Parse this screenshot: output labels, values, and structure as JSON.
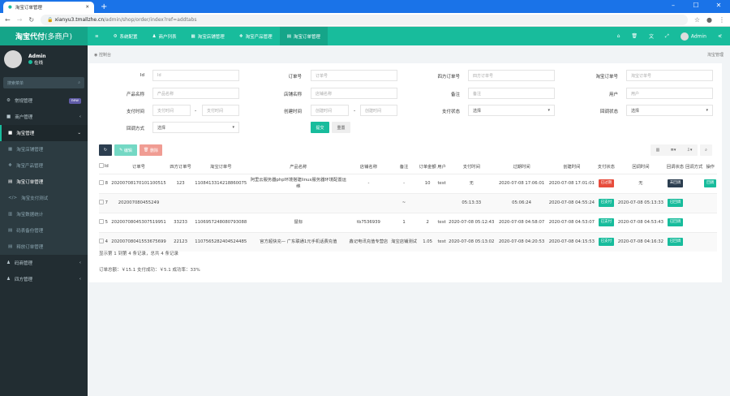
{
  "browser": {
    "tab_title": "淘宝订单管理",
    "url_domain": "xianyu3.tmallzhe.cn",
    "url_path": "/admin/shop/order/index?ref=addtabs"
  },
  "app": {
    "logo_main": "淘宝代付",
    "logo_sub": "(多商户)",
    "admin": "Admin"
  },
  "topnav": [
    {
      "label": "系统配置",
      "icon": "gear"
    },
    {
      "label": "商户列表",
      "icon": "user"
    },
    {
      "label": "淘宝店铺管理",
      "icon": "bank"
    },
    {
      "label": "淘宝产品管理",
      "icon": "cubes"
    },
    {
      "label": "淘宝订单管理",
      "icon": "id-card"
    }
  ],
  "user": {
    "name": "Admin",
    "status": "在线"
  },
  "sidebar": {
    "search_placeholder": "搜索菜单",
    "items": [
      {
        "label": "常规管理",
        "badge": "new"
      },
      {
        "label": "商户管理"
      },
      {
        "label": "淘宝管理"
      }
    ],
    "sub": [
      {
        "label": "淘宝店铺管理"
      },
      {
        "label": "淘宝产品管理"
      },
      {
        "label": "淘宝订单管理"
      },
      {
        "label": "淘宝支付测试"
      },
      {
        "label": "淘宝数据统计"
      },
      {
        "label": "码表备份管理"
      },
      {
        "label": "释放订单管理"
      }
    ],
    "bottom": [
      {
        "label": "码商管理"
      },
      {
        "label": "四方管理"
      }
    ]
  },
  "breadcrumb": {
    "left": "控制台",
    "right": "淘宝管理"
  },
  "form": {
    "id": {
      "label": "Id",
      "placeholder": "Id"
    },
    "order_no": {
      "label": "订单号",
      "placeholder": "订单号"
    },
    "sf_no": {
      "label": "四方订单号",
      "placeholder": "四方订单号"
    },
    "tb_no": {
      "label": "淘宝订单号",
      "placeholder": "淘宝订单号"
    },
    "product": {
      "label": "产品名称",
      "placeholder": "产品名称"
    },
    "shop": {
      "label": "店铺名称",
      "placeholder": "店铺名称"
    },
    "remark": {
      "label": "备注",
      "placeholder": "备注"
    },
    "user": {
      "label": "用户",
      "placeholder": "用户"
    },
    "pay_time": {
      "label": "支付时间",
      "placeholder": "支付时间"
    },
    "create_time": {
      "label": "创建时间",
      "placeholder": "创建时间"
    },
    "pay_status": {
      "label": "支付状态",
      "value": "选择"
    },
    "cb_status": {
      "label": "回调状态",
      "value": "选择"
    },
    "cb_method": {
      "label": "回调方式",
      "value": "选择"
    },
    "submit": "提交",
    "reset": "重置"
  },
  "toolbar": {
    "edit": "编辑",
    "delete": "删除"
  },
  "table": {
    "headers": [
      "Id",
      "订单号",
      "四方订单号",
      "淘宝订单号",
      "产品名称",
      "店铺名称",
      "备注",
      "订单金额",
      "用户",
      "支付时间",
      "过期时间",
      "创建时间",
      "支付状态",
      "回调时间",
      "回调状态",
      "回调方式",
      "操作"
    ],
    "rows": [
      [
        "8",
        "20200708170101100515",
        "123",
        "1108413314218860075",
        "阿里云服务器php环境搭建linux服务器环境配置运维",
        "-",
        "-",
        "10",
        "test",
        "无",
        "2020-07-08 17:06:01",
        "2020-07-08 17:01:01",
        "已过期",
        "无",
        "未回调",
        "",
        "回调"
      ],
      [
        "7",
        "202007080455249",
        "",
        "",
        "",
        "",
        "~",
        "",
        "",
        "05:13:33",
        "05:06:24",
        "2020-07-08 04:55:24",
        "已支付",
        "2020-07-08 05:13:33",
        "已回调",
        "",
        ""
      ],
      [
        "5",
        "20200708045307519951",
        "33233",
        "1106957248080793088",
        "鼠标",
        "tb7536939",
        "1",
        "2",
        "test",
        "2020-07-08 05:12:43",
        "2020-07-08 04:58:07",
        "2020-07-08 04:53:07",
        "已支付",
        "2020-07-08 04:53:43",
        "已回调",
        "",
        ""
      ],
      [
        "4",
        "20200708041553675699",
        "22123",
        "1107565282404524485",
        "官方超快充— 广东联通1元手机话费充值",
        "鑫记电讯充值专营店",
        "淘宝店铺测试",
        "1.05",
        "test",
        "2020-07-08 05:13:02",
        "2020-07-08 04:20:53",
        "2020-07-08 04:15:53",
        "已支付",
        "2020-07-08 04:16:32",
        "已回调",
        "",
        ""
      ]
    ]
  },
  "footer": {
    "summary": "显示第 1 到第 4 条记录，总共 4 条记录",
    "totals": "订单总额：￥15.1 支付成功：￥5.1 成功率：33%"
  },
  "colors": {
    "primary": "#18bc9c",
    "sidebar": "#222d32",
    "danger": "#e74c3c",
    "dark": "#2c3e50"
  }
}
